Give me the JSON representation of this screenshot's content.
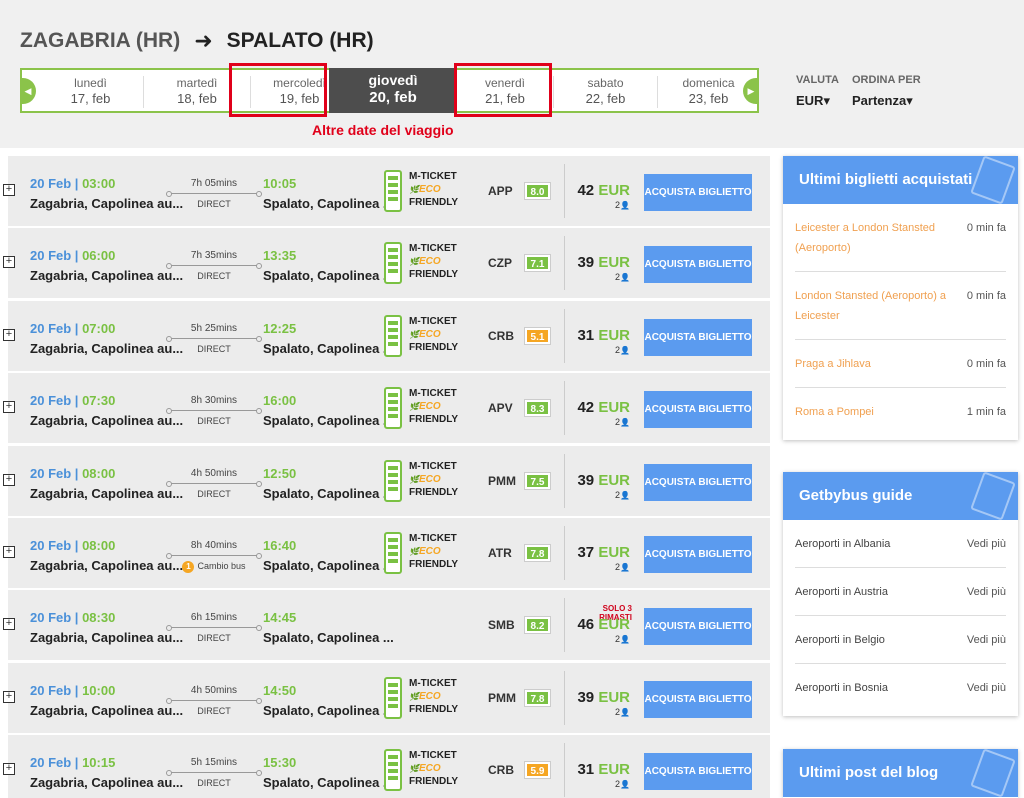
{
  "route": {
    "from": "ZAGABRIA (HR)",
    "to": "SPALATO (HR)"
  },
  "dates": [
    {
      "day": "lunedì",
      "date": "17, feb"
    },
    {
      "day": "martedì",
      "date": "18, feb"
    },
    {
      "day": "mercoledì",
      "date": "19, feb"
    },
    {
      "day": "giovedì",
      "date": "20, feb",
      "active": true
    },
    {
      "day": "venerdì",
      "date": "21, feb"
    },
    {
      "day": "sabato",
      "date": "22, feb"
    },
    {
      "day": "domenica",
      "date": "23, feb"
    }
  ],
  "annotation": "Altre date del viaggio",
  "currency": {
    "label": "VALUTA",
    "value": "EUR"
  },
  "sort": {
    "label": "ORDINA PER",
    "value": "Partenza"
  },
  "colors": {
    "accent_green": "#7ac143",
    "blue": "#5b9bef",
    "highlight_red": "#e0001a",
    "score_green": "#7ac143",
    "score_orange": "#f5a623"
  },
  "trips": [
    {
      "date": "20 Feb",
      "dep": "03:00",
      "from": "Zagabria, Capolinea au...",
      "duration": "7h 05mins",
      "type": "DIRECT",
      "arr": "10:05",
      "to": "Spalato, Capolinea ...",
      "mticket": true,
      "operator": "APP",
      "score": "8.0",
      "score_color": "#7ac143",
      "price": "42",
      "currency": "EUR",
      "seats": "2",
      "buy": "ACQUISTA BIGLIETTO"
    },
    {
      "date": "20 Feb",
      "dep": "06:00",
      "from": "Zagabria, Capolinea au...",
      "duration": "7h 35mins",
      "type": "DIRECT",
      "arr": "13:35",
      "to": "Spalato, Capolinea ...",
      "mticket": true,
      "operator": "CZP",
      "score": "7.1",
      "score_color": "#7ac143",
      "price": "39",
      "currency": "EUR",
      "seats": "2",
      "buy": "ACQUISTA BIGLIETTO"
    },
    {
      "date": "20 Feb",
      "dep": "07:00",
      "from": "Zagabria, Capolinea au...",
      "duration": "5h 25mins",
      "type": "DIRECT",
      "arr": "12:25",
      "to": "Spalato, Capolinea ...",
      "mticket": true,
      "operator": "CRB",
      "score": "5.1",
      "score_color": "#f5a623",
      "price": "31",
      "currency": "EUR",
      "seats": "2",
      "buy": "ACQUISTA BIGLIETTO"
    },
    {
      "date": "20 Feb",
      "dep": "07:30",
      "from": "Zagabria, Capolinea au...",
      "duration": "8h 30mins",
      "type": "DIRECT",
      "arr": "16:00",
      "to": "Spalato, Capolinea ...",
      "mticket": true,
      "operator": "APV",
      "score": "8.3",
      "score_color": "#7ac143",
      "price": "42",
      "currency": "EUR",
      "seats": "2",
      "buy": "ACQUISTA BIGLIETTO"
    },
    {
      "date": "20 Feb",
      "dep": "08:00",
      "from": "Zagabria, Capolinea au...",
      "duration": "4h 50mins",
      "type": "DIRECT",
      "arr": "12:50",
      "to": "Spalato, Capolinea ...",
      "mticket": true,
      "operator": "PMM",
      "score": "7.5",
      "score_color": "#7ac143",
      "price": "39",
      "currency": "EUR",
      "seats": "2",
      "buy": "ACQUISTA BIGLIETTO"
    },
    {
      "date": "20 Feb",
      "dep": "08:00",
      "from": "Zagabria, Capolinea au...",
      "duration": "8h 40mins",
      "type": "Cambio bus",
      "changes": "1",
      "arr": "16:40",
      "to": "Spalato, Capolinea ...",
      "mticket": true,
      "operator": "ATR",
      "score": "7.8",
      "score_color": "#7ac143",
      "price": "37",
      "currency": "EUR",
      "seats": "2",
      "buy": "ACQUISTA BIGLIETTO"
    },
    {
      "date": "20 Feb",
      "dep": "08:30",
      "from": "Zagabria, Capolinea au...",
      "duration": "6h 15mins",
      "type": "DIRECT",
      "arr": "14:45",
      "to": "Spalato, Capolinea ...",
      "mticket": false,
      "operator": "SMB",
      "score": "8.2",
      "score_color": "#7ac143",
      "scarcity": "SOLO 3 RIMASTI",
      "price": "46",
      "currency": "EUR",
      "seats": "2",
      "buy": "ACQUISTA BIGLIETTO"
    },
    {
      "date": "20 Feb",
      "dep": "10:00",
      "from": "Zagabria, Capolinea au...",
      "duration": "4h 50mins",
      "type": "DIRECT",
      "arr": "14:50",
      "to": "Spalato, Capolinea ...",
      "mticket": true,
      "operator": "PMM",
      "score": "7.8",
      "score_color": "#7ac143",
      "price": "39",
      "currency": "EUR",
      "seats": "2",
      "buy": "ACQUISTA BIGLIETTO"
    },
    {
      "date": "20 Feb",
      "dep": "10:15",
      "from": "Zagabria, Capolinea au...",
      "duration": "5h 15mins",
      "type": "DIRECT",
      "arr": "15:30",
      "to": "Spalato, Capolinea ...",
      "mticket": true,
      "operator": "CRB",
      "score": "5.9",
      "score_color": "#f5a623",
      "price": "31",
      "currency": "EUR",
      "seats": "2",
      "buy": "ACQUISTA BIGLIETTO"
    }
  ],
  "mticket_text": {
    "line1": "M-TICKET",
    "line2": "ECO",
    "line3": "FRIENDLY"
  },
  "recent": {
    "title": "Ultimi biglietti acquistati",
    "items": [
      {
        "route": "Leicester a London Stansted (Aeroporto)",
        "time": "0 min fa"
      },
      {
        "route": "London Stansted (Aeroporto) a Leicester",
        "time": "0 min fa"
      },
      {
        "route": "Praga a Jihlava",
        "time": "0 min fa"
      },
      {
        "route": "Roma a Pompei",
        "time": "1 min fa"
      }
    ]
  },
  "guide": {
    "title": "Getbybus guide",
    "items": [
      {
        "label": "Aeroporti in Albania",
        "link": "Vedi più"
      },
      {
        "label": "Aeroporti in Austria",
        "link": "Vedi più"
      },
      {
        "label": "Aeroporti in Belgio",
        "link": "Vedi più"
      },
      {
        "label": "Aeroporti in Bosnia",
        "link": "Vedi più"
      }
    ]
  },
  "blog": {
    "title": "Ultimi post del blog"
  }
}
